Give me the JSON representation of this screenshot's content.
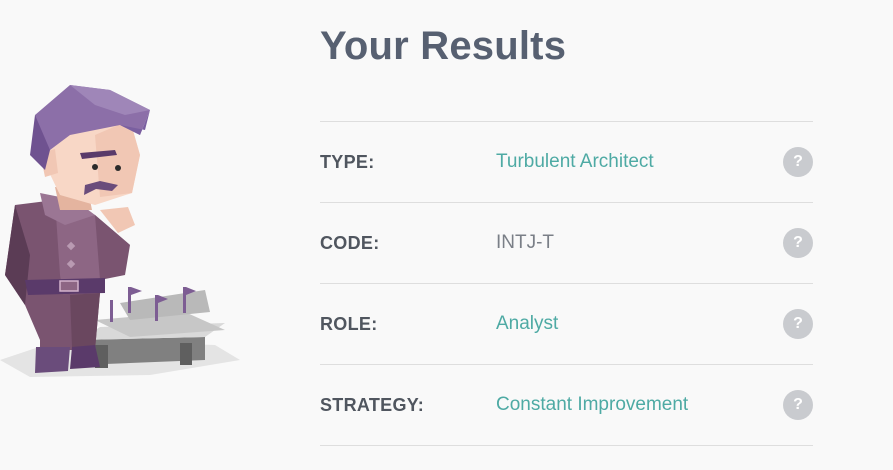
{
  "title": "Your Results",
  "rows": [
    {
      "label": "TYPE:",
      "value": "Turbulent Architect",
      "accent": true,
      "help": "?"
    },
    {
      "label": "CODE:",
      "value": "INTJ-T",
      "accent": false,
      "help": "?"
    },
    {
      "label": "ROLE:",
      "value": "Analyst",
      "accent": true,
      "help": "?"
    },
    {
      "label": "STRATEGY:",
      "value": "Constant Improvement",
      "accent": true,
      "help": "?"
    }
  ],
  "colors": {
    "title": "#576071",
    "accent": "#4eaaa4",
    "label": "#50565f",
    "help_bg": "#c9cbcf",
    "divider": "#dedede"
  },
  "icons": {
    "help": "question-circle-icon",
    "illustration": "architect-character-illustration"
  }
}
